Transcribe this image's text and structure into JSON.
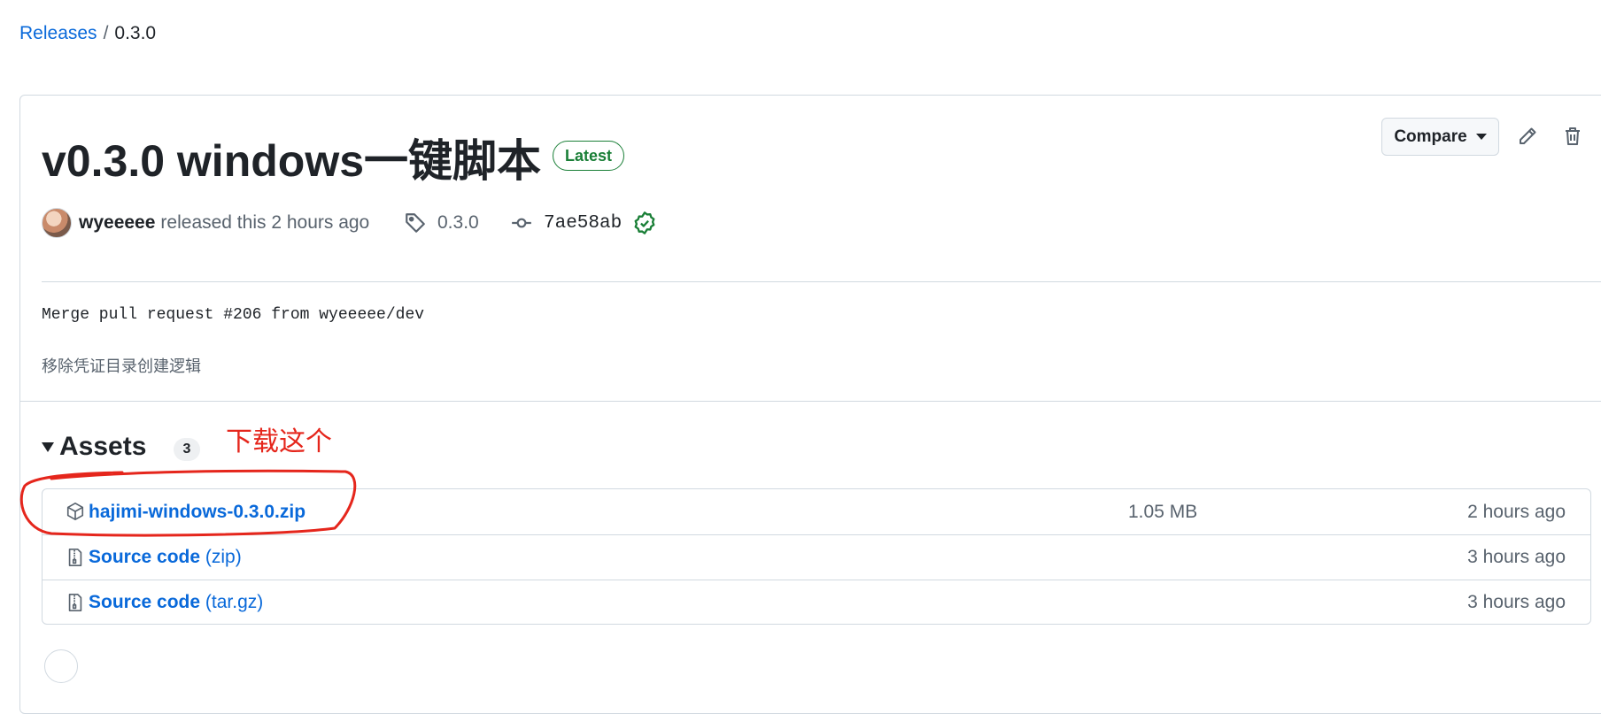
{
  "breadcrumb": {
    "link": "Releases",
    "separator": "/",
    "current": "0.3.0"
  },
  "release": {
    "title": "v0.3.0 windows一键脚本",
    "latest_badge": "Latest",
    "compare_label": "Compare",
    "author": "wyeeeee",
    "released_text": "released this 2 hours ago",
    "tag": "0.3.0",
    "commit": "7ae58ab",
    "body_line1": "Merge pull request #206 from wyeeeee/dev",
    "body_line2": "移除凭证目录创建逻辑"
  },
  "assets": {
    "heading": "Assets",
    "count": "3",
    "annotation": "下载这个",
    "rows": [
      {
        "name": "hajimi-windows-0.3.0.zip",
        "ext": "",
        "size": "1.05 MB",
        "time": "2 hours ago",
        "icon": "package-icon"
      },
      {
        "name": "Source code",
        "ext": "(zip)",
        "size": "",
        "time": "3 hours ago",
        "icon": "file-zip-icon"
      },
      {
        "name": "Source code",
        "ext": "(tar.gz)",
        "size": "",
        "time": "3 hours ago",
        "icon": "file-zip-icon"
      }
    ]
  },
  "colors": {
    "link": "#0969da",
    "success": "#1a7f37",
    "annotation": "#e5261c",
    "border": "#d1d9e0",
    "muted": "#59636e"
  }
}
